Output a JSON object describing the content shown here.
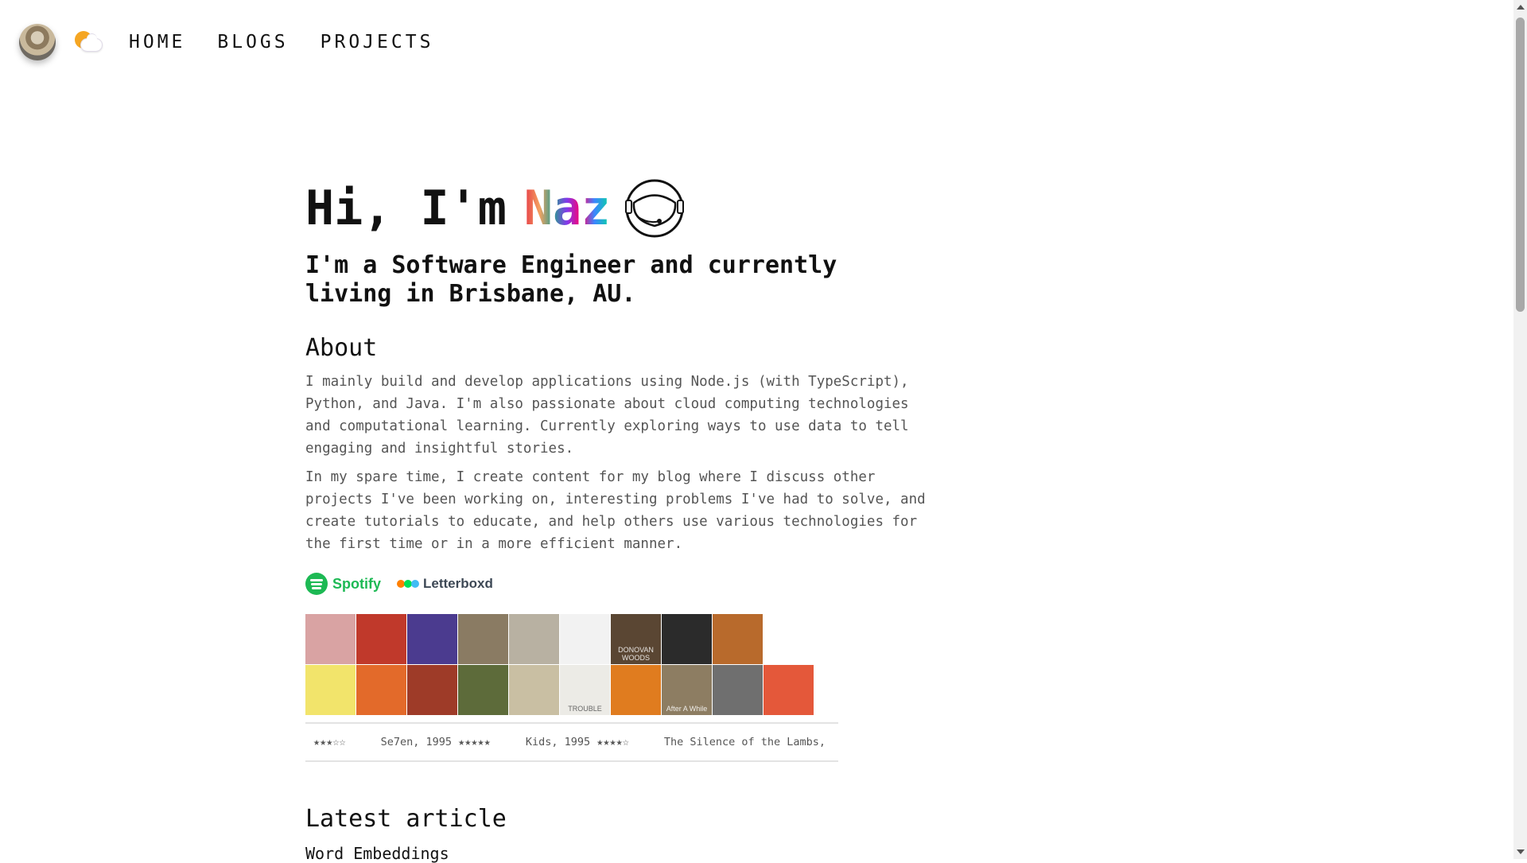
{
  "nav": {
    "links": [
      "HOME",
      "BLOGS",
      "PROJECTS"
    ]
  },
  "hero": {
    "greeting": "Hi, I'm",
    "name": "Naz",
    "subtitle": "I'm a Software Engineer and currently living in Brisbane, AU."
  },
  "about": {
    "title": "About",
    "paragraphs": [
      "I mainly build and develop applications using Node.js (with TypeScript), Python, and Java. I'm also passionate about cloud computing technologies and computational learning. Currently exploring ways to use data to tell engaging and insightful stories.",
      "In my spare time, I create content for my blog where I discuss other projects I've been working on, interesting problems I've had to solve, and create tutorials to educate, and help others use various technologies for the first time or in a more efficient manner."
    ]
  },
  "socials": {
    "spotify_label": "Spotify",
    "letterboxd_label": "Letterboxd",
    "letterboxd_colors": [
      "#ff8000",
      "#00e054",
      "#40bcf4"
    ]
  },
  "albums": {
    "covers": [
      {
        "color": "#d9a3a3",
        "label": ""
      },
      {
        "color": "#c0392b",
        "label": ""
      },
      {
        "color": "#4b3b8f",
        "label": ""
      },
      {
        "color": "#8a7b63",
        "label": ""
      },
      {
        "color": "#b8b1a2",
        "label": ""
      },
      {
        "color": "#f2f2f2",
        "label": ""
      },
      {
        "color": "#5a4633",
        "label": "DONOVAN WOODS"
      },
      {
        "color": "#2b2b2b",
        "label": ""
      },
      {
        "color": "#b86a2c",
        "label": ""
      },
      {
        "color": "#ffffff",
        "label": ""
      },
      {
        "color": "#f2e46b",
        "label": ""
      },
      {
        "color": "#e36a2a",
        "label": ""
      },
      {
        "color": "#9e3b28",
        "label": ""
      },
      {
        "color": "#5d6b3a",
        "label": ""
      },
      {
        "color": "#c9bfa3",
        "label": ""
      },
      {
        "color": "#ecebe6",
        "label": "TROUBLE"
      },
      {
        "color": "#e07c1f",
        "label": ""
      },
      {
        "color": "#8d7d62",
        "label": "After A While"
      },
      {
        "color": "#6f6f6f",
        "label": ""
      },
      {
        "color": "#e4583a",
        "label": ""
      },
      {
        "color": "#3c2a2a",
        "label": ""
      }
    ]
  },
  "ticker": {
    "items": [
      "★★★☆☆",
      "Se7en, 1995 ★★★★★",
      "Kids, 1995 ★★★★☆",
      "The Silence of the Lambs,"
    ]
  },
  "latest": {
    "title": "Latest article",
    "article_title": "Word Embeddings"
  }
}
